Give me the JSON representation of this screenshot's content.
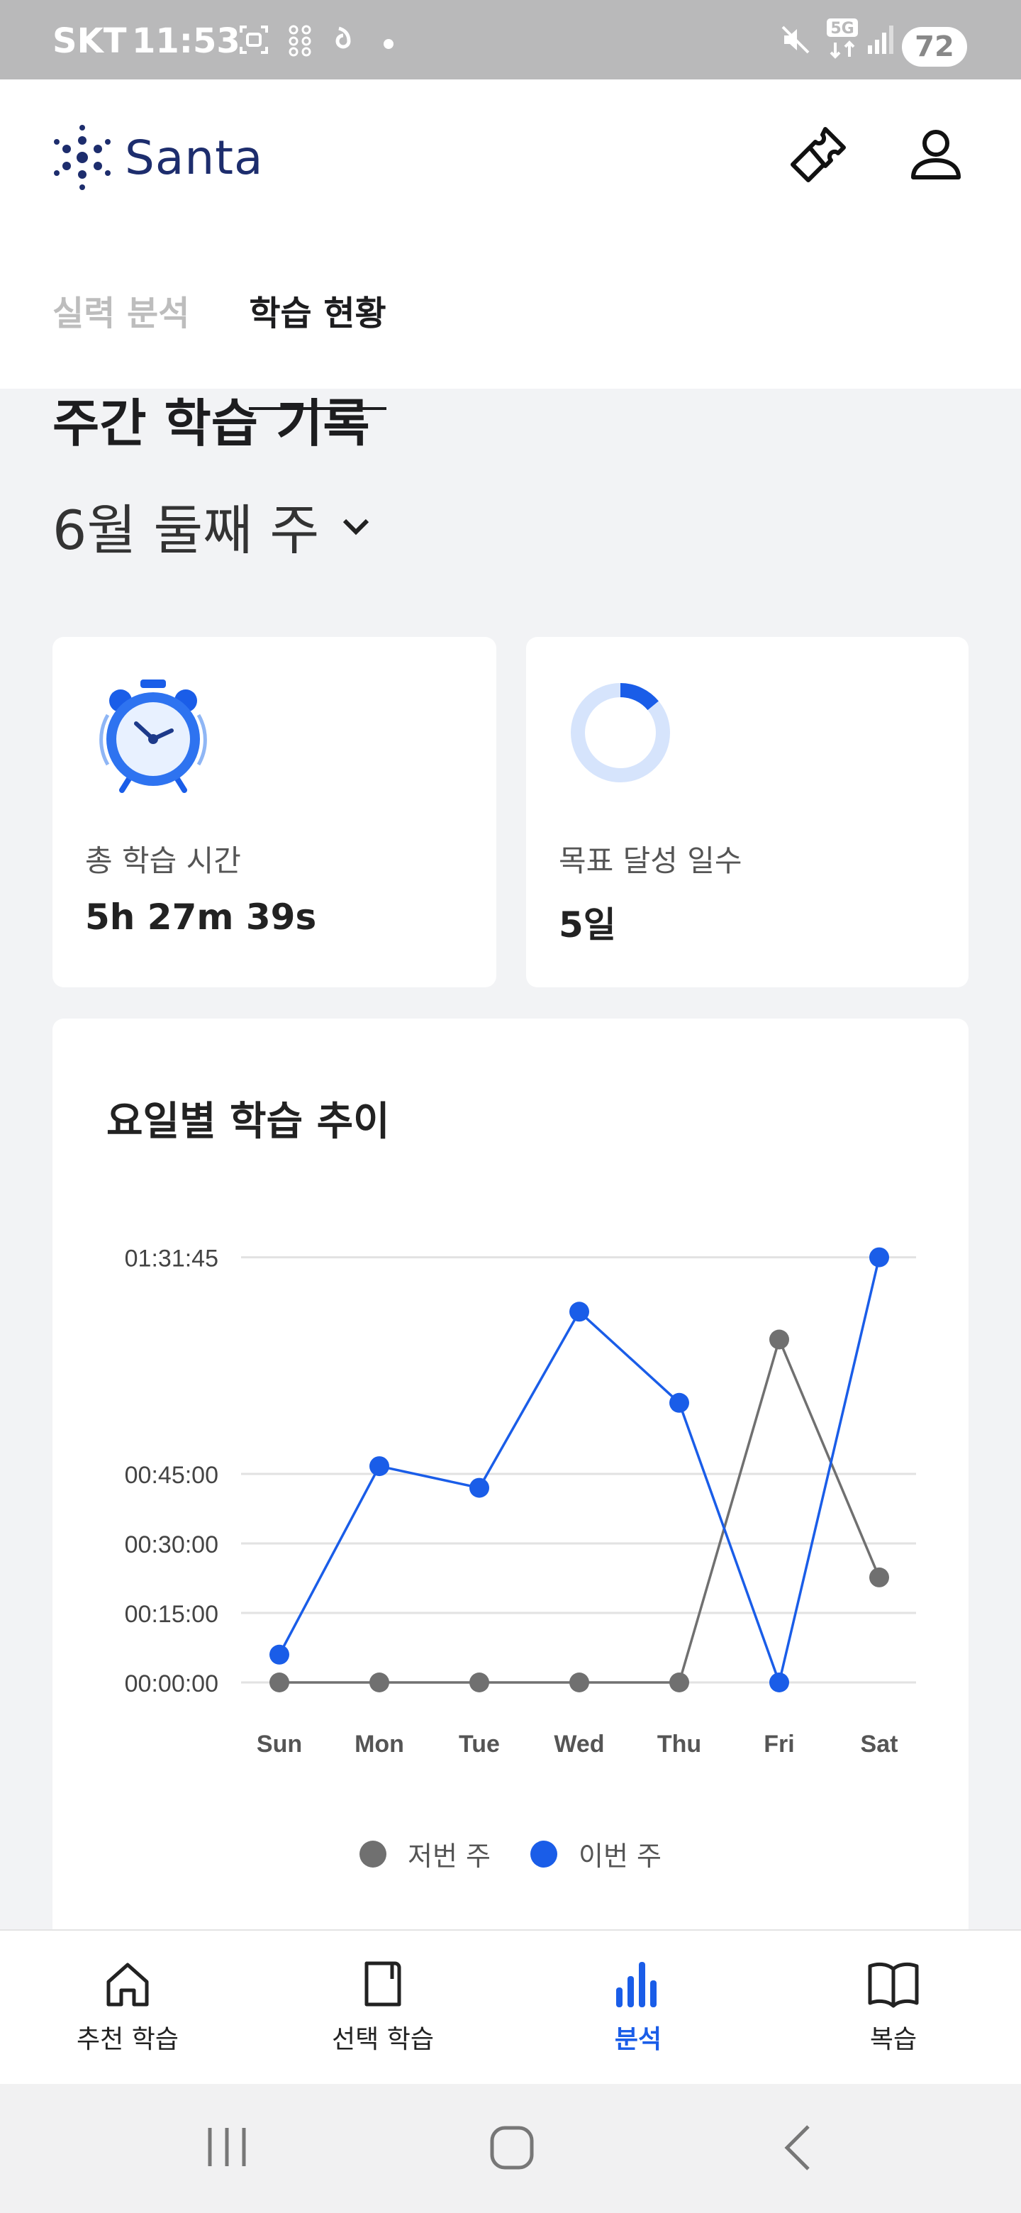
{
  "status_bar": {
    "carrier": "SKT",
    "time": "11:53",
    "battery": "72",
    "network": "5G"
  },
  "app": {
    "brand": "Santa"
  },
  "tabs": [
    {
      "label": "실력 분석",
      "active": false
    },
    {
      "label": "학습 현황",
      "active": true
    }
  ],
  "section": {
    "title": "주간 학습 기록",
    "week": "6월 둘째 주"
  },
  "cards": {
    "study_time": {
      "label": "총 학습 시간",
      "value": "5h 27m 39s",
      "icon": "alarm-clock-icon"
    },
    "goal_days": {
      "label": "목표 달성 일수",
      "value": "5일",
      "icon": "progress-ring-icon",
      "progress": 0.14
    }
  },
  "chart": {
    "title": "요일별 학습 추이"
  },
  "chart_data": {
    "type": "line",
    "x": [
      "Sun",
      "Mon",
      "Tue",
      "Wed",
      "Thu",
      "Fri",
      "Sat"
    ],
    "y_ticks": [
      "00:00:00",
      "00:15:00",
      "00:30:00",
      "00:45:00",
      "01:31:45"
    ],
    "y_tick_seconds": [
      0,
      900,
      1800,
      2700,
      5505
    ],
    "y_unit": "seconds",
    "series": [
      {
        "name": "저번 주",
        "color": "#707070",
        "values": [
          0,
          0,
          0,
          0,
          0,
          4440,
          1360
        ]
      },
      {
        "name": "이번 주",
        "color": "#1a5de8",
        "values": [
          360,
          2800,
          2520,
          4800,
          3620,
          0,
          5505
        ]
      }
    ],
    "legend_position": "bottom-center",
    "grid": true
  },
  "nav": [
    {
      "label": "추천 학습",
      "icon": "home-icon",
      "active": false
    },
    {
      "label": "선택 학습",
      "icon": "book-page-icon",
      "active": false
    },
    {
      "label": "분석",
      "icon": "bar-chart-icon",
      "active": true
    },
    {
      "label": "복습",
      "icon": "open-book-icon",
      "active": false
    }
  ]
}
